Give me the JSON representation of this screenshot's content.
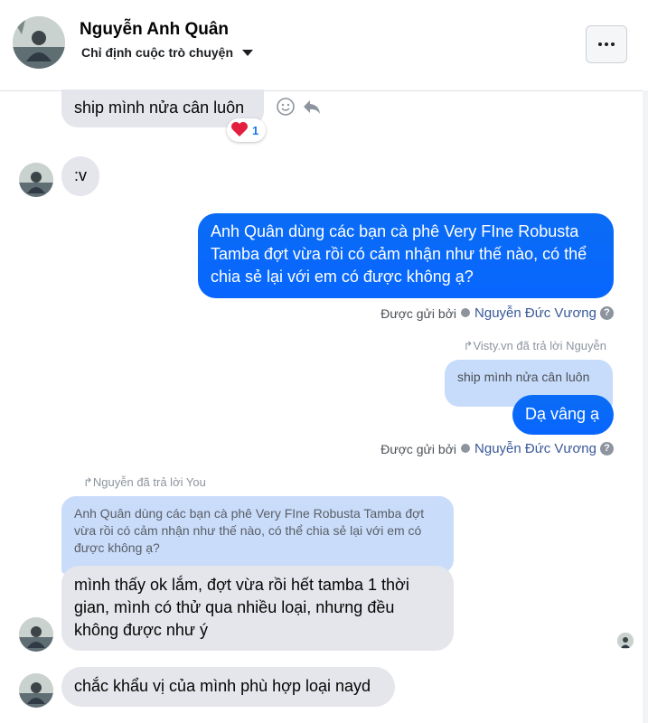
{
  "header": {
    "name": "Nguyễn Anh Quân",
    "subtitle": "Chỉ định cuộc trò chuyện",
    "more_icon": "more-dots-icon"
  },
  "messages": {
    "m1": {
      "text": "ship mình nửa cân luôn",
      "reaction": "❤️",
      "reaction_count": "1"
    },
    "m2": {
      "text": ":v"
    },
    "m3": {
      "text": "Anh Quân dùng các bạn cà phê Very FIne Robusta Tamba đợt vừa rồi  có cảm nhận như thế nào, có thể chia sẻ lại với em có được không ạ?"
    },
    "m3_meta": {
      "prefix": "Được gửi bởi",
      "sender": "Nguyễn Đức Vương"
    },
    "m4_reply_label": "Visty.vn đã trả lời Nguyễn",
    "m4_quote": "ship mình nửa cân luôn",
    "m4": {
      "text": "Dạ vâng ạ"
    },
    "m4_meta": {
      "prefix": "Được gửi bởi",
      "sender": "Nguyễn Đức Vương"
    },
    "m5_reply_label": "Nguyễn đã trả lời You",
    "m5_quote": "Anh Quân dùng các bạn cà phê Very FIne Robusta Tamba đợt vừa rồi có cảm nhận như thế nào, có thể chia sẻ lại với em có được không ạ?",
    "m5": {
      "text": "mình thấy ok lắm, đợt vừa rồi hết tamba 1 thời gian, mình có thử qua nhiều loại, nhưng đều không được như ý"
    },
    "m6": {
      "text": "chắc khẩu vị của mình phù hợp loại nayd"
    }
  },
  "colors": {
    "outgoing_bubble": "#0866ff",
    "incoming_bubble": "#e4e6eb",
    "quote_bubble": "#c7dcfb",
    "sender_link": "#385898"
  }
}
